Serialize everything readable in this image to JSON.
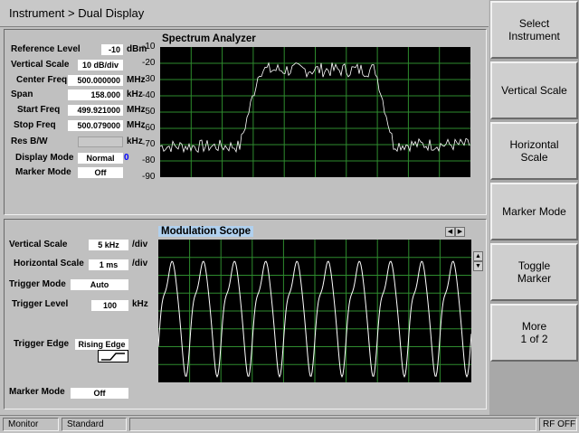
{
  "title": "Instrument > Dual Display",
  "softkeys": [
    "Select\nInstrument",
    "Vertical Scale",
    "Horizontal\nScale",
    "Marker Mode",
    "Toggle\nMarker",
    "More\n1 of 2"
  ],
  "spectrum": {
    "title": "Spectrum Analyzer",
    "reference_level": {
      "label": "Reference Level",
      "value": "-10",
      "unit": "dBm"
    },
    "vertical_scale": {
      "label": "Vertical Scale",
      "value": "10 dB/div"
    },
    "center_freq": {
      "label": "Center Freq",
      "value": "500.000000",
      "unit": "MHz"
    },
    "span": {
      "label": "Span",
      "value": "158.000",
      "unit": "kHz"
    },
    "start_freq": {
      "label": "Start Freq",
      "value": "499.921000",
      "unit": "MHz"
    },
    "stop_freq": {
      "label": "Stop Freq",
      "value": "500.079000",
      "unit": "MHz"
    },
    "res_bw": {
      "label": "Res B/W",
      "value": "",
      "unit": "kHz"
    },
    "display_mode": {
      "label": "Display Mode",
      "value": "Normal",
      "index": "0"
    },
    "marker_mode": {
      "label": "Marker Mode",
      "value": "Off"
    },
    "y_ticks": [
      "-10",
      "-20",
      "-30",
      "-40",
      "-50",
      "-60",
      "-70",
      "-80",
      "-90"
    ],
    "ylim": [
      -90,
      -10
    ],
    "grid": true
  },
  "modulation": {
    "title": "Modulation Scope",
    "vertical_scale": {
      "label": "Vertical Scale",
      "value": "5 kHz",
      "unit": "/div"
    },
    "horizontal_scale": {
      "label": "Horizontal Scale",
      "value": "1 ms",
      "unit": "/div"
    },
    "trigger_mode": {
      "label": "Trigger Mode",
      "value": "Auto"
    },
    "trigger_level": {
      "label": "Trigger Level",
      "value": "100",
      "unit": "kHz"
    },
    "trigger_edge": {
      "label": "Trigger Edge",
      "value": "Rising Edge"
    },
    "marker_mode": {
      "label": "Marker Mode",
      "value": "Off"
    },
    "grid": true
  },
  "status": {
    "mode": "Monitor",
    "standard": "Standard",
    "rf": "RF OFF"
  },
  "colors": {
    "trace": "#ffffff",
    "grid": "#2e8b2e",
    "plot_bg": "#000000",
    "highlight": "#b0d0ee",
    "index_blue": "#0000ff"
  }
}
